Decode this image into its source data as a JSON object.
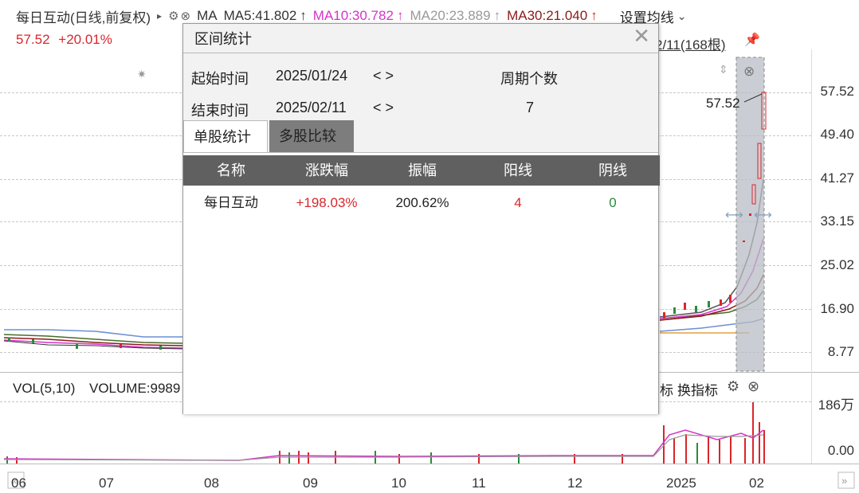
{
  "header": {
    "stock_title": "每日互动(日线,前复权)",
    "arrow": "▸",
    "ma_label": "MA",
    "ma5": "MA5:41.802",
    "ma5_arrow": "↑",
    "ma10": "MA10:30.782",
    "ma10_arrow": "↑",
    "ma20": "MA20:23.889",
    "ma20_arrow": "↑",
    "ma30": "MA30:21.040",
    "ma30_arrow": "↑",
    "set_ma": "设置均线",
    "set_ma_arrow": "⌄",
    "price": "57.52",
    "change": "+20.01%",
    "date_range_partial": "2/11(168根)",
    "colors": {
      "ma5": "#333333",
      "ma10": "#d633c9",
      "ma20": "#999999",
      "ma30": "#8b1a1a",
      "up": "#d9262b",
      "down": "#2a8c3a"
    }
  },
  "price_axis": [
    "57.52",
    "49.40",
    "41.27",
    "33.15",
    "25.02",
    "16.90",
    "8.77"
  ],
  "price_annotation": "57.52",
  "volume": {
    "label": "VOL(5,10)",
    "volume_text": "VOLUME:9989",
    "indicator_partial": "标",
    "switch_indicator": "换指标",
    "axis": [
      "186万",
      "0.00"
    ]
  },
  "x_axis": [
    "06",
    "07",
    "08",
    "09",
    "10",
    "11",
    "12",
    "2025",
    "02"
  ],
  "dialog": {
    "title": "区间统计",
    "close": "✕",
    "start_label": "起始时间",
    "start_value": "2025/01/24",
    "start_nav": "< >",
    "end_label": "结束时间",
    "end_value": "2025/02/11",
    "end_nav": "< >",
    "period_label": "周期个数",
    "period_value": "7",
    "tabs": [
      "单股统计",
      "多股比较"
    ],
    "table": {
      "headers": [
        "名称",
        "涨跌幅",
        "振幅",
        "阳线",
        "阴线"
      ],
      "rows": [
        [
          "每日互动",
          "+198.03%",
          "200.62%",
          "4",
          "0"
        ]
      ]
    }
  }
}
